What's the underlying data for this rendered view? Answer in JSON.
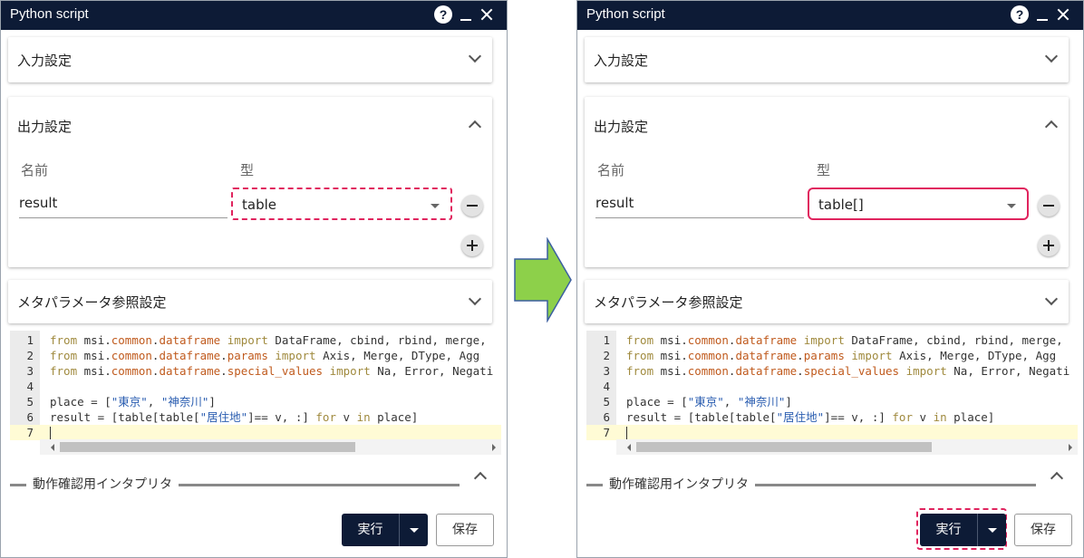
{
  "window": {
    "title": "Python script"
  },
  "sections": {
    "input_label": "入力設定",
    "output_label": "出力設定",
    "meta_label": "メタパラメータ参照設定",
    "interpreter_label": "動作確認用インタプリタ"
  },
  "output_columns": {
    "name_header": "名前",
    "type_header": "型"
  },
  "before": {
    "name_value": "result",
    "type_value": "table"
  },
  "after": {
    "name_value": "result",
    "type_value": "table[]"
  },
  "code_lines": [
    {
      "n": "1",
      "segments": [
        [
          "kw",
          "from "
        ],
        [
          "",
          "msi."
        ],
        [
          "mod",
          "common"
        ],
        [
          "",
          "."
        ],
        [
          "mod",
          "dataframe"
        ],
        [
          "kw",
          " import "
        ],
        [
          "",
          "DataFrame, cbind, rbind, merge,"
        ]
      ]
    },
    {
      "n": "2",
      "segments": [
        [
          "kw",
          "from "
        ],
        [
          "",
          "msi."
        ],
        [
          "mod",
          "common"
        ],
        [
          "",
          "."
        ],
        [
          "mod",
          "dataframe"
        ],
        [
          "",
          "."
        ],
        [
          "mod",
          "params"
        ],
        [
          "kw",
          " import "
        ],
        [
          "",
          "Axis, Merge, DType, Agg"
        ]
      ]
    },
    {
      "n": "3",
      "segments": [
        [
          "kw",
          "from "
        ],
        [
          "",
          "msi."
        ],
        [
          "mod",
          "common"
        ],
        [
          "",
          "."
        ],
        [
          "mod",
          "dataframe"
        ],
        [
          "",
          "."
        ],
        [
          "mod",
          "special_values"
        ],
        [
          "kw",
          " import "
        ],
        [
          "",
          "Na, Error, Negati"
        ]
      ]
    },
    {
      "n": "4",
      "segments": []
    },
    {
      "n": "5",
      "segments": [
        [
          "",
          "place = ["
        ],
        [
          "str",
          "\"東京\""
        ],
        [
          "",
          ", "
        ],
        [
          "str",
          "\"神奈川\""
        ],
        [
          "",
          "]"
        ]
      ]
    },
    {
      "n": "6",
      "segments": [
        [
          "",
          "result = [table[table["
        ],
        [
          "str",
          "\"居住地\""
        ],
        [
          "",
          "]== v, :] "
        ],
        [
          "kw",
          "for"
        ],
        [
          "",
          " v "
        ],
        [
          "kw",
          "in"
        ],
        [
          "",
          " place]"
        ]
      ]
    },
    {
      "n": "7",
      "segments": []
    }
  ],
  "buttons": {
    "run_label": "実行",
    "save_label": "保存"
  },
  "colors": {
    "titlebar": "#0d1b36",
    "highlight": "#e0245e",
    "arrow_fill": "#8dd04a",
    "arrow_stroke": "#3b5fa0"
  }
}
